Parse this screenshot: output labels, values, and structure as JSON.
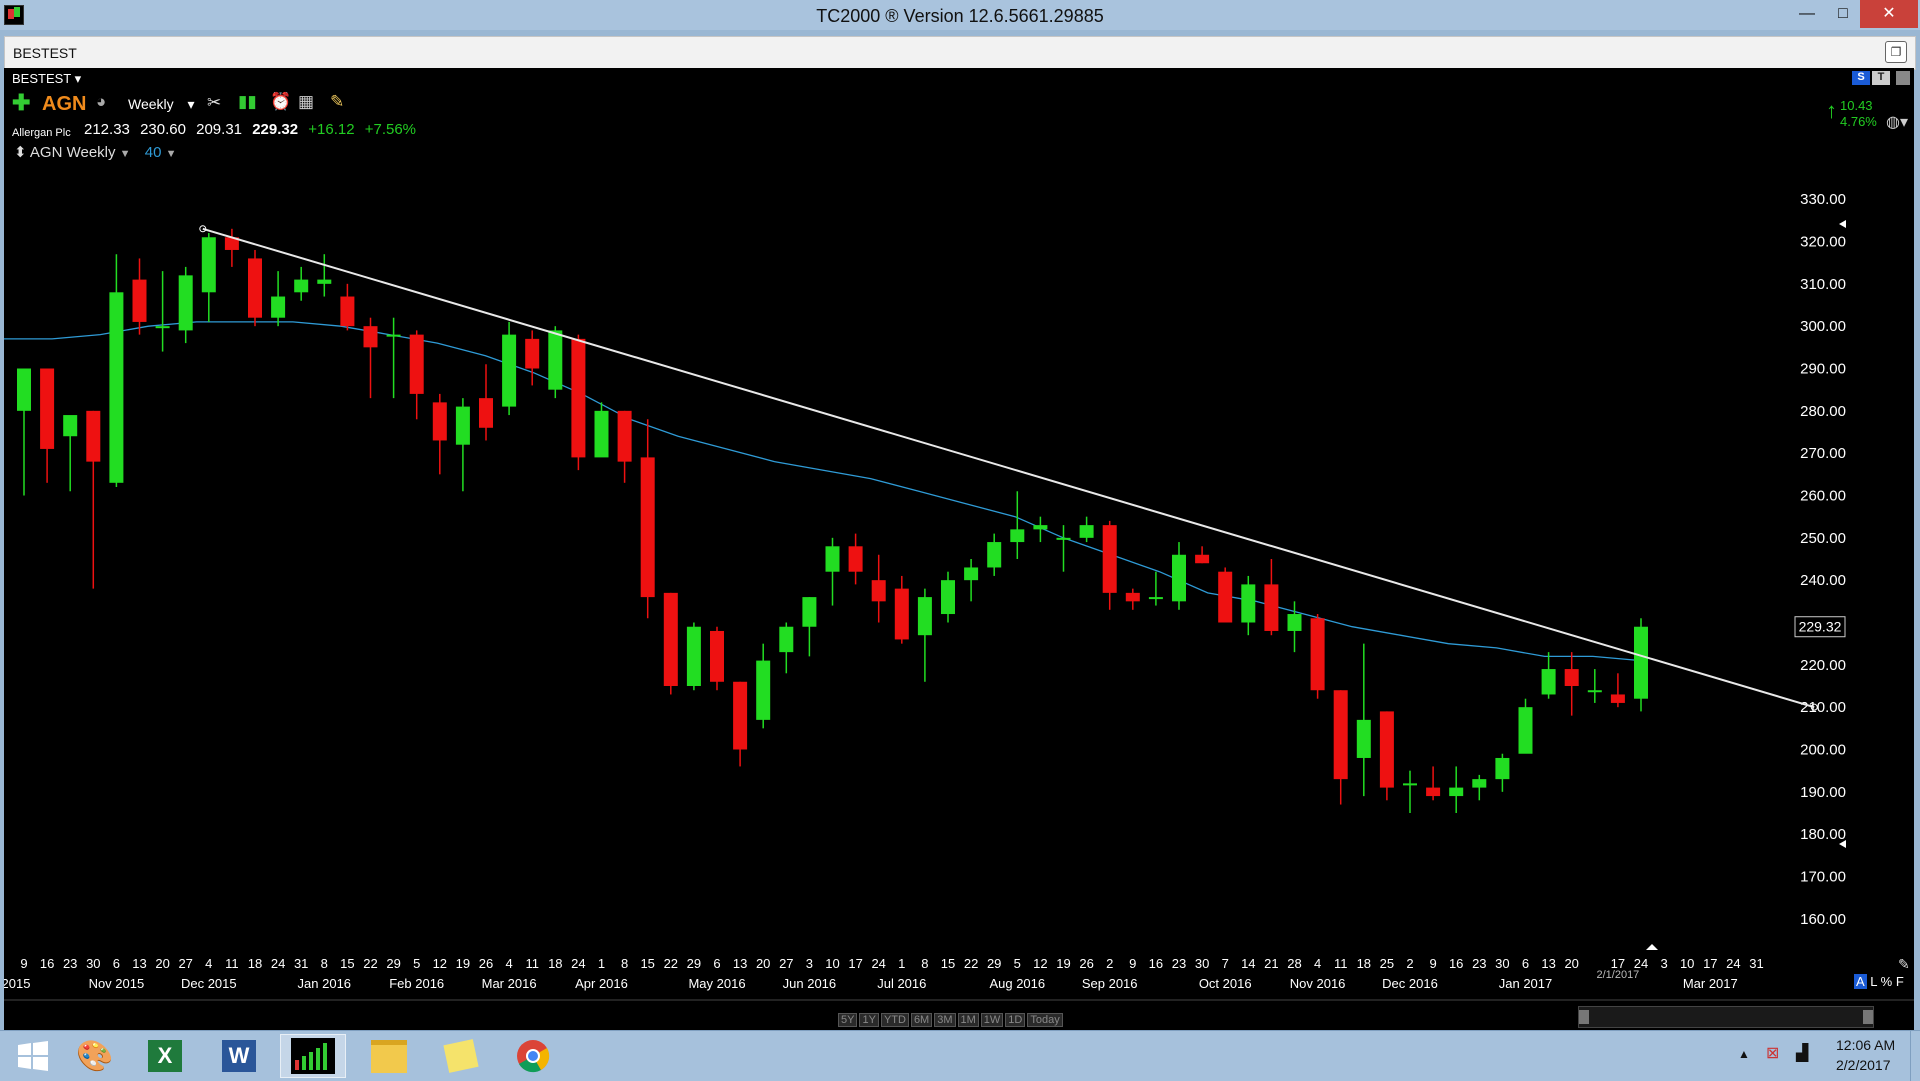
{
  "window": {
    "title": "TC2000 ® Version 12.6.5661.29885",
    "minimize": "—",
    "maximize": "□",
    "close": "✕"
  },
  "doc_tab": {
    "label": "BESTEST"
  },
  "chart_header": {
    "watchlist": "BESTEST",
    "symbol": "AGN",
    "timeframe": "Weekly",
    "company": "Allergan Plc",
    "open": "212.33",
    "high": "230.60",
    "low": "209.31",
    "close": "229.32",
    "change": "+16.12",
    "change_pct": "+7.56%",
    "study_label": "AGN Weekly",
    "ma_period": "40",
    "right_change": "10.43",
    "right_change_pct": "4.76%",
    "price_tag": "229.32",
    "scale_buttons": {
      "s": "S",
      "t": "T"
    },
    "bottom_right": [
      "A",
      "L",
      "%",
      "F"
    ]
  },
  "colors": {
    "up": "#22dd22",
    "down": "#ee1111",
    "ma": "#2f9bd6",
    "trendline": "#e8e8e8",
    "positive": "#22cc22"
  },
  "period_buttons": [
    "5Y",
    "1Y",
    "YTD",
    "6M",
    "3M",
    "1M",
    "1W",
    "1D",
    "Today"
  ],
  "chart_data": {
    "type": "candlestick",
    "symbol": "AGN",
    "timeframe": "Weekly",
    "ylim": [
      155,
      335
    ],
    "y_ticks": [
      "330.00",
      "320.00",
      "310.00",
      "300.00",
      "290.00",
      "280.00",
      "270.00",
      "260.00",
      "250.00",
      "240.00",
      "230.00",
      "220.00",
      "210.00",
      "200.00",
      "190.00",
      "180.00",
      "170.00",
      "160.00"
    ],
    "x_day_labels": [
      "9",
      "16",
      "23",
      "30",
      "6",
      "13",
      "20",
      "27",
      "4",
      "11",
      "18",
      "24",
      "31",
      "8",
      "15",
      "22",
      "29",
      "5",
      "12",
      "19",
      "26",
      "4",
      "11",
      "18",
      "24",
      "1",
      "8",
      "15",
      "22",
      "29",
      "6",
      "13",
      "20",
      "27",
      "3",
      "10",
      "17",
      "24",
      "1",
      "8",
      "15",
      "22",
      "29",
      "5",
      "12",
      "19",
      "26",
      "2",
      "9",
      "16",
      "23",
      "30",
      "7",
      "14",
      "21",
      "28",
      "4",
      "11",
      "18",
      "25",
      "2",
      "9",
      "16",
      "23",
      "30",
      "6",
      "13",
      "20",
      "",
      "17",
      "24",
      "3",
      "10",
      "17",
      "24",
      "31"
    ],
    "x_month_labels": [
      [
        "2015",
        0
      ],
      [
        "Nov 2015",
        4
      ],
      [
        "Dec 2015",
        8
      ],
      [
        "Jan 2016",
        13
      ],
      [
        "Feb 2016",
        17
      ],
      [
        "Mar 2016",
        21
      ],
      [
        "Apr 2016",
        25
      ],
      [
        "May 2016",
        30
      ],
      [
        "Jun 2016",
        34
      ],
      [
        "Jul 2016",
        38
      ],
      [
        "Aug 2016",
        43
      ],
      [
        "Sep 2016",
        47
      ],
      [
        "Oct 2016",
        52
      ],
      [
        "Nov 2016",
        56
      ],
      [
        "Dec 2016",
        60
      ],
      [
        "Jan 2017",
        65
      ],
      [
        "2/1/2017",
        69
      ],
      [
        "Mar 2017",
        73
      ]
    ],
    "candles": [
      {
        "o": 280,
        "h": 290,
        "l": 260,
        "c": 290
      },
      {
        "o": 290,
        "h": 290,
        "l": 263,
        "c": 271
      },
      {
        "o": 274,
        "h": 277,
        "l": 261,
        "c": 279
      },
      {
        "o": 280,
        "h": 280,
        "l": 238,
        "c": 268
      },
      {
        "o": 263,
        "h": 317,
        "l": 262,
        "c": 308
      },
      {
        "o": 311,
        "h": 316,
        "l": 298,
        "c": 301
      },
      {
        "o": 300,
        "h": 313,
        "l": 294,
        "c": 300
      },
      {
        "o": 299,
        "h": 314,
        "l": 296,
        "c": 312
      },
      {
        "o": 308,
        "h": 322,
        "l": 301,
        "c": 321
      },
      {
        "o": 321,
        "h": 323,
        "l": 314,
        "c": 318
      },
      {
        "o": 316,
        "h": 318,
        "l": 300,
        "c": 302
      },
      {
        "o": 302,
        "h": 313,
        "l": 300,
        "c": 307
      },
      {
        "o": 308,
        "h": 314,
        "l": 306,
        "c": 311
      },
      {
        "o": 310,
        "h": 317,
        "l": 307,
        "c": 311
      },
      {
        "o": 307,
        "h": 310,
        "l": 299,
        "c": 300
      },
      {
        "o": 300,
        "h": 302,
        "l": 283,
        "c": 295
      },
      {
        "o": 298,
        "h": 302,
        "l": 283,
        "c": 298
      },
      {
        "o": 298,
        "h": 299,
        "l": 278,
        "c": 284
      },
      {
        "o": 282,
        "h": 284,
        "l": 265,
        "c": 273
      },
      {
        "o": 272,
        "h": 283,
        "l": 261,
        "c": 281
      },
      {
        "o": 283,
        "h": 291,
        "l": 273,
        "c": 276
      },
      {
        "o": 281,
        "h": 301,
        "l": 279,
        "c": 298
      },
      {
        "o": 297,
        "h": 299,
        "l": 286,
        "c": 290
      },
      {
        "o": 285,
        "h": 300,
        "l": 283,
        "c": 299
      },
      {
        "o": 297,
        "h": 298,
        "l": 266,
        "c": 269
      },
      {
        "o": 269,
        "h": 282,
        "l": 270,
        "c": 280
      },
      {
        "o": 280,
        "h": 280,
        "l": 263,
        "c": 268
      },
      {
        "o": 269,
        "h": 278,
        "l": 231,
        "c": 236
      },
      {
        "o": 237,
        "h": 237,
        "l": 213,
        "c": 215
      },
      {
        "o": 215,
        "h": 230,
        "l": 214,
        "c": 229
      },
      {
        "o": 228,
        "h": 229,
        "l": 214,
        "c": 216
      },
      {
        "o": 216,
        "h": 216,
        "l": 196,
        "c": 200
      },
      {
        "o": 207,
        "h": 225,
        "l": 205,
        "c": 221
      },
      {
        "o": 223,
        "h": 230,
        "l": 218,
        "c": 229
      },
      {
        "o": 229,
        "h": 236,
        "l": 222,
        "c": 236
      },
      {
        "o": 242,
        "h": 250,
        "l": 234,
        "c": 248
      },
      {
        "o": 248,
        "h": 251,
        "l": 239,
        "c": 242
      },
      {
        "o": 240,
        "h": 246,
        "l": 230,
        "c": 235
      },
      {
        "o": 238,
        "h": 241,
        "l": 225,
        "c": 226
      },
      {
        "o": 227,
        "h": 238,
        "l": 216,
        "c": 236
      },
      {
        "o": 232,
        "h": 242,
        "l": 230,
        "c": 240
      },
      {
        "o": 240,
        "h": 245,
        "l": 235,
        "c": 243
      },
      {
        "o": 243,
        "h": 251,
        "l": 241,
        "c": 249
      },
      {
        "o": 249,
        "h": 261,
        "l": 245,
        "c": 252
      },
      {
        "o": 252,
        "h": 255,
        "l": 249,
        "c": 253
      },
      {
        "o": 250,
        "h": 253,
        "l": 242,
        "c": 250
      },
      {
        "o": 250,
        "h": 255,
        "l": 249,
        "c": 253
      },
      {
        "o": 253,
        "h": 254,
        "l": 233,
        "c": 237
      },
      {
        "o": 237,
        "h": 238,
        "l": 233,
        "c": 235
      },
      {
        "o": 236,
        "h": 242,
        "l": 234,
        "c": 236
      },
      {
        "o": 235,
        "h": 249,
        "l": 233,
        "c": 246
      },
      {
        "o": 246,
        "h": 248,
        "l": 244,
        "c": 244
      },
      {
        "o": 242,
        "h": 243,
        "l": 230,
        "c": 230
      },
      {
        "o": 230,
        "h": 241,
        "l": 227,
        "c": 239
      },
      {
        "o": 239,
        "h": 245,
        "l": 227,
        "c": 228
      },
      {
        "o": 228,
        "h": 235,
        "l": 223,
        "c": 232
      },
      {
        "o": 231,
        "h": 232,
        "l": 212,
        "c": 214
      },
      {
        "o": 214,
        "h": 214,
        "l": 187,
        "c": 193
      },
      {
        "o": 198,
        "h": 225,
        "l": 189,
        "c": 207
      },
      {
        "o": 209,
        "h": 209,
        "l": 188,
        "c": 191
      },
      {
        "o": 192,
        "h": 195,
        "l": 185,
        "c": 192
      },
      {
        "o": 191,
        "h": 196,
        "l": 188,
        "c": 189
      },
      {
        "o": 189,
        "h": 196,
        "l": 185,
        "c": 191
      },
      {
        "o": 191,
        "h": 194,
        "l": 188,
        "c": 193
      },
      {
        "o": 193,
        "h": 199,
        "l": 190,
        "c": 198
      },
      {
        "o": 199,
        "h": 212,
        "l": 200,
        "c": 210
      },
      {
        "o": 213,
        "h": 223,
        "l": 212,
        "c": 219
      },
      {
        "o": 219,
        "h": 223,
        "l": 208,
        "c": 215
      },
      {
        "o": 214,
        "h": 219,
        "l": 211,
        "c": 214
      },
      {
        "o": 213,
        "h": 218,
        "l": 210,
        "c": 211
      },
      {
        "o": 212,
        "h": 231,
        "l": 209,
        "c": 229
      }
    ],
    "moving_average_40": [
      297,
      297,
      298,
      300,
      301,
      301,
      301,
      300,
      298,
      296,
      293,
      289,
      284,
      278,
      274,
      271,
      268,
      266,
      264,
      261,
      258,
      255,
      250,
      246,
      242,
      237,
      235,
      232,
      229,
      227,
      225,
      224,
      222,
      222,
      221
    ],
    "trendline": {
      "start": {
        "index": 8,
        "y": 323
      },
      "end": {
        "index": 77.5,
        "y": 210
      }
    }
  },
  "taskbar": {
    "apps": [
      "windows-start",
      "paint",
      "excel",
      "word",
      "tc2000",
      "explorer",
      "sticky-notes",
      "chrome"
    ],
    "time": "12:06 AM",
    "date": "2/2/2017"
  }
}
